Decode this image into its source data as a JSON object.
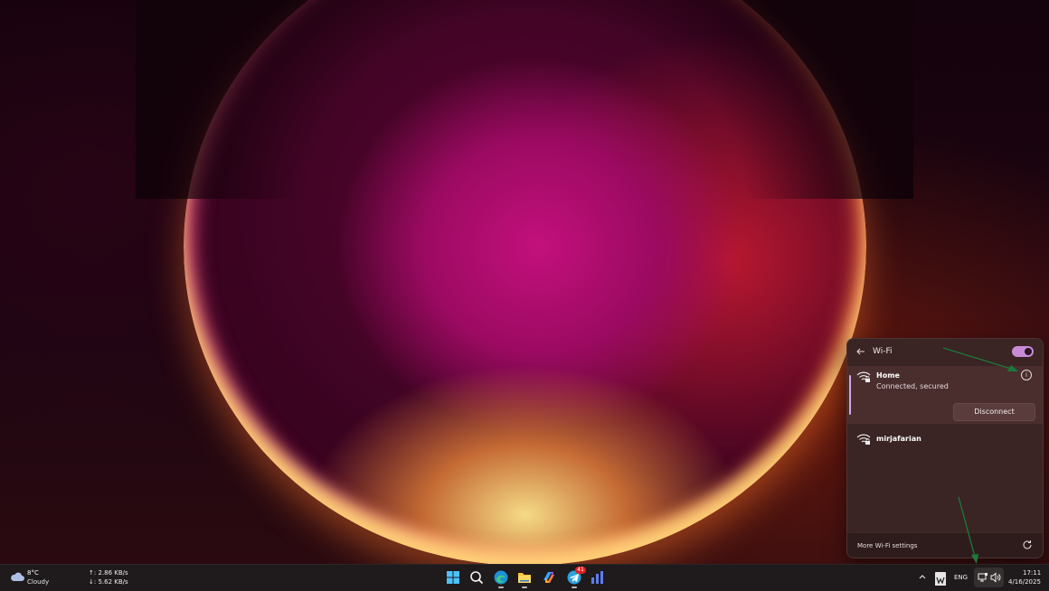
{
  "wifi_flyout": {
    "title": "Wi-Fi",
    "toggle_state": "on",
    "networks": [
      {
        "name": "Home",
        "status": "Connected, secured",
        "action_label": "Disconnect"
      },
      {
        "name": "mirjafarian"
      }
    ],
    "footer_link": "More Wi-Fi settings"
  },
  "taskbar": {
    "weather": {
      "temperature": "8°C",
      "condition": "Cloudy"
    },
    "net_speed": {
      "upload": "↑: 2.86 KB/s",
      "download": "↓: 5.62 KB/s"
    },
    "apps": [
      {
        "icon": "windows-start-icon"
      },
      {
        "icon": "search-icon"
      },
      {
        "icon": "edge-icon"
      },
      {
        "icon": "file-explorer-icon"
      },
      {
        "icon": "copilot-icon"
      },
      {
        "icon": "telegram-icon",
        "badge": "41"
      },
      {
        "icon": "chart-app-icon"
      }
    ],
    "tray": {
      "language": "ENG",
      "time": "17:11",
      "date": "4/16/2025"
    }
  },
  "colors": {
    "accent": "#d5a5e6",
    "annotation_arrow": "#1d7a3a"
  }
}
